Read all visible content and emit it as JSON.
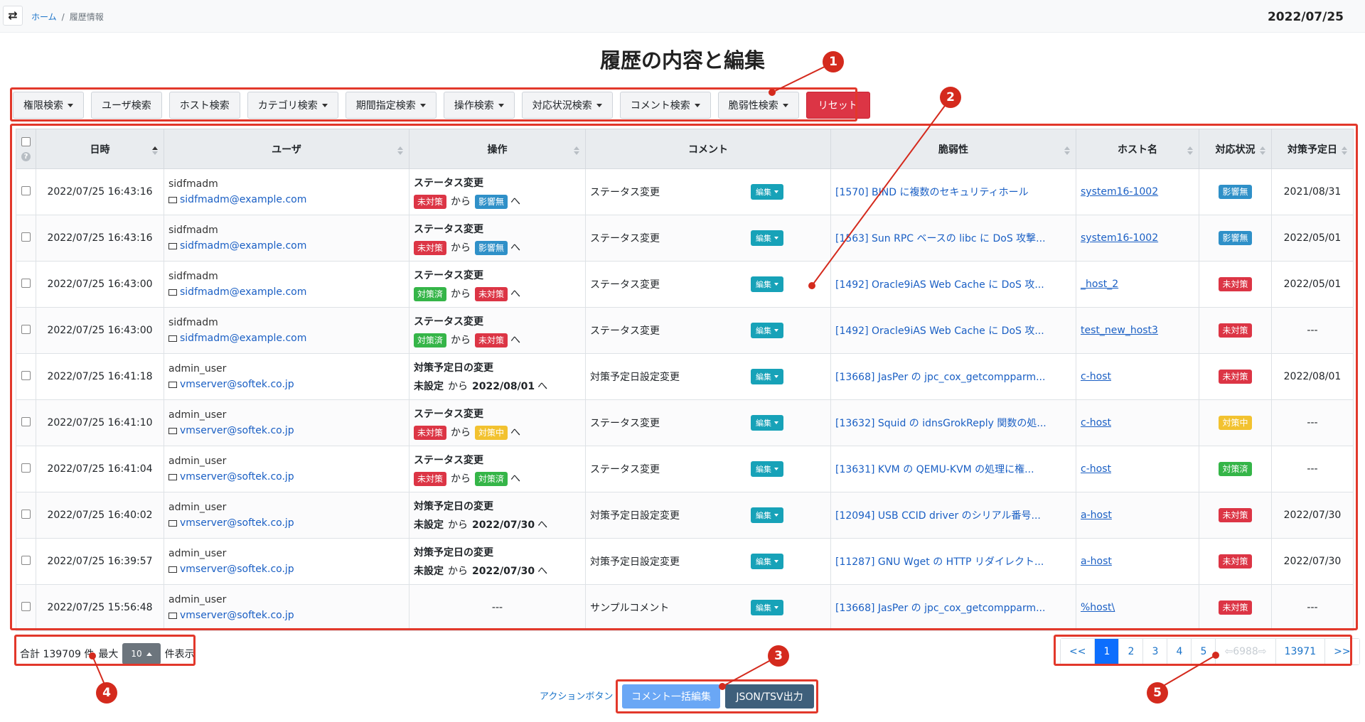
{
  "header": {
    "breadcrumb": [
      {
        "label": "ホーム"
      },
      {
        "label": "履歴情報"
      }
    ],
    "breadcrumb_sep": "/",
    "date": "2022/07/25",
    "toggle_icon": "swap-icon"
  },
  "page_title": "履歴の内容と編集",
  "toolbar": {
    "buttons": [
      {
        "label": "権限検索",
        "dropdown": true
      },
      {
        "label": "ユーザ検索",
        "dropdown": false
      },
      {
        "label": "ホスト検索",
        "dropdown": false
      },
      {
        "label": "カテゴリ検索",
        "dropdown": true
      },
      {
        "label": "期間指定検索",
        "dropdown": true
      },
      {
        "label": "操作検索",
        "dropdown": true
      },
      {
        "label": "対応状況検索",
        "dropdown": true
      },
      {
        "label": "コメント検索",
        "dropdown": true
      },
      {
        "label": "脆弱性検索",
        "dropdown": true
      }
    ],
    "reset_label": "リセット"
  },
  "table": {
    "help_mark": "?",
    "headers": [
      "日時",
      "ユーザ",
      "操作",
      "コメント",
      "脆弱性",
      "ホスト名",
      "対応状況",
      "対策予定日"
    ],
    "edit_label": "編集",
    "rows": [
      {
        "datetime": "2022/07/25 16:43:16",
        "user": "sidfmadm",
        "email": "sidfmadm@example.com",
        "op_title": "ステータス変更",
        "from": "未対策",
        "from_color": "red",
        "from_badge": true,
        "mid": "から",
        "to": "影響無",
        "to_color": "blue",
        "to_badge": true,
        "end": "へ",
        "comment": "ステータス変更",
        "vuln": "[1570] BIND に複数のセキュリティホール",
        "host": "system16-1002",
        "status": "影響無",
        "status_color": "blue",
        "planned": "2021/08/31"
      },
      {
        "datetime": "2022/07/25 16:43:16",
        "user": "sidfmadm",
        "email": "sidfmadm@example.com",
        "op_title": "ステータス変更",
        "from": "未対策",
        "from_color": "red",
        "from_badge": true,
        "mid": "から",
        "to": "影響無",
        "to_color": "blue",
        "to_badge": true,
        "end": "へ",
        "comment": "ステータス変更",
        "vuln": "[1563] Sun RPC ベースの libc に DoS 攻撃...",
        "host": "system16-1002",
        "status": "影響無",
        "status_color": "blue",
        "planned": "2022/05/01"
      },
      {
        "datetime": "2022/07/25 16:43:00",
        "user": "sidfmadm",
        "email": "sidfmadm@example.com",
        "op_title": "ステータス変更",
        "from": "対策済",
        "from_color": "green",
        "from_badge": true,
        "mid": "から",
        "to": "未対策",
        "to_color": "red",
        "to_badge": true,
        "end": "へ",
        "comment": "ステータス変更",
        "vuln": "[1492] Oracle9iAS Web Cache に DoS 攻...",
        "host": "_host_2",
        "status": "未対策",
        "status_color": "red",
        "planned": "2022/05/01"
      },
      {
        "datetime": "2022/07/25 16:43:00",
        "user": "sidfmadm",
        "email": "sidfmadm@example.com",
        "op_title": "ステータス変更",
        "from": "対策済",
        "from_color": "green",
        "from_badge": true,
        "mid": "から",
        "to": "未対策",
        "to_color": "red",
        "to_badge": true,
        "end": "へ",
        "comment": "ステータス変更",
        "vuln": "[1492] Oracle9iAS Web Cache に DoS 攻...",
        "host": "test_new_host3",
        "status": "未対策",
        "status_color": "red",
        "planned": "---"
      },
      {
        "datetime": "2022/07/25 16:41:18",
        "user": "admin_user",
        "email": "vmserver@softek.co.jp",
        "op_title": "対策予定日の変更",
        "from": "未設定",
        "from_color": "",
        "from_badge": false,
        "mid": "から",
        "to": "2022/08/01",
        "to_color": "",
        "to_badge": false,
        "end": "へ",
        "comment": "対策予定日設定変更",
        "vuln": "[13668] JasPer の jpc_cox_getcompparm...",
        "host": "c-host",
        "status": "未対策",
        "status_color": "red",
        "planned": "2022/08/01"
      },
      {
        "datetime": "2022/07/25 16:41:10",
        "user": "admin_user",
        "email": "vmserver@softek.co.jp",
        "op_title": "ステータス変更",
        "from": "未対策",
        "from_color": "red",
        "from_badge": true,
        "mid": "から",
        "to": "対策中",
        "to_color": "yellow",
        "to_badge": true,
        "end": "へ",
        "comment": "ステータス変更",
        "vuln": "[13632] Squid の idnsGrokReply 関数の処...",
        "host": "c-host",
        "status": "対策中",
        "status_color": "yellow",
        "planned": "---"
      },
      {
        "datetime": "2022/07/25 16:41:04",
        "user": "admin_user",
        "email": "vmserver@softek.co.jp",
        "op_title": "ステータス変更",
        "from": "未対策",
        "from_color": "red",
        "from_badge": true,
        "mid": "から",
        "to": "対策済",
        "to_color": "green",
        "to_badge": true,
        "end": "へ",
        "comment": "ステータス変更",
        "vuln": "[13631] KVM の QEMU-KVM の処理に権...",
        "host": "c-host",
        "status": "対策済",
        "status_color": "green",
        "planned": "---"
      },
      {
        "datetime": "2022/07/25 16:40:02",
        "user": "admin_user",
        "email": "vmserver@softek.co.jp",
        "op_title": "対策予定日の変更",
        "from": "未設定",
        "from_color": "",
        "from_badge": false,
        "mid": "から",
        "to": "2022/07/30",
        "to_color": "",
        "to_badge": false,
        "end": "へ",
        "comment": "対策予定日設定変更",
        "vuln": "[12094] USB CCID driver のシリアル番号...",
        "host": "a-host",
        "status": "未対策",
        "status_color": "red",
        "planned": "2022/07/30"
      },
      {
        "datetime": "2022/07/25 16:39:57",
        "user": "admin_user",
        "email": "vmserver@softek.co.jp",
        "op_title": "対策予定日の変更",
        "from": "未設定",
        "from_color": "",
        "from_badge": false,
        "mid": "から",
        "to": "2022/07/30",
        "to_color": "",
        "to_badge": false,
        "end": "へ",
        "comment": "対策予定日設定変更",
        "vuln": "[11287] GNU Wget の HTTP リダイレクト...",
        "host": "a-host",
        "status": "未対策",
        "status_color": "red",
        "planned": "2022/07/30"
      },
      {
        "datetime": "2022/07/25 15:56:48",
        "user": "admin_user",
        "email": "vmserver@softek.co.jp",
        "op_title": "",
        "op_dash": "---",
        "from": "",
        "mid": "",
        "to": "",
        "end": "",
        "comment": "サンプルコメント",
        "vuln": "[13668] JasPer の jpc_cox_getcompparm...",
        "host": "%host\\",
        "status": "未対策",
        "status_color": "red",
        "planned": "---"
      }
    ]
  },
  "summary": {
    "prefix": "合計 139709 件",
    "max_label": "最大",
    "per_page": "10",
    "suffix": "件表示"
  },
  "pagination": {
    "pages": [
      {
        "label": "<<",
        "state": "normal"
      },
      {
        "label": "1",
        "state": "active"
      },
      {
        "label": "2",
        "state": "normal"
      },
      {
        "label": "3",
        "state": "normal"
      },
      {
        "label": "4",
        "state": "normal"
      },
      {
        "label": "5",
        "state": "normal"
      },
      {
        "label": "⇦6988⇨",
        "state": "disabled"
      },
      {
        "label": "13971",
        "state": "normal"
      },
      {
        "label": ">>",
        "state": "normal"
      }
    ]
  },
  "actions": {
    "label": "アクションボタン",
    "bulk_edit": "コメント一括編集",
    "export": "JSON/TSV出力"
  },
  "annotations": [
    "1",
    "2",
    "3",
    "4",
    "5"
  ],
  "colors": {
    "annotation": "#e2382b",
    "red": "#dc3545",
    "blue": "#2f90c8",
    "green": "#35b548",
    "yellow": "#f2c230",
    "active_page": "#0d6efd"
  }
}
